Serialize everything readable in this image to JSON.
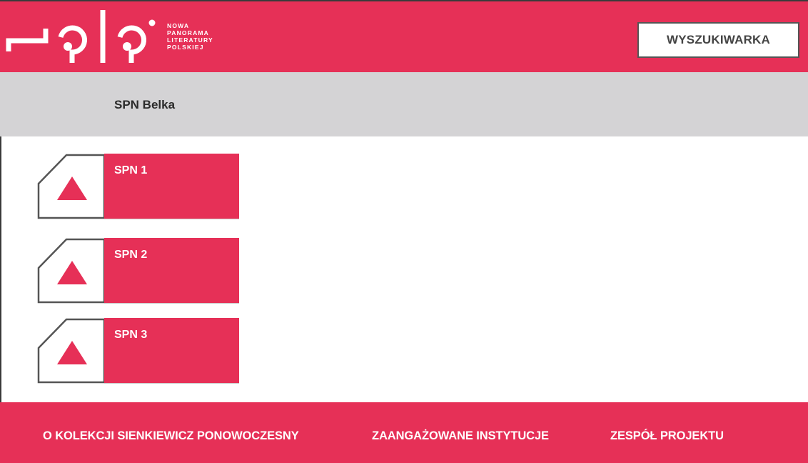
{
  "colors": {
    "accent": "#e63057",
    "band": "#d4d3d5",
    "text_dark": "#2b2b2b",
    "outline": "#555555"
  },
  "logo": {
    "icon": "nplp-logo-icon",
    "lines": [
      "NOWA",
      "PANORAMA",
      "LITERATURY",
      "POLSKIEJ"
    ]
  },
  "header": {
    "search_label": "WYSZUKIWARKA"
  },
  "band": {
    "title": "SPN Belka"
  },
  "items": [
    {
      "label": "SPN 1",
      "icon": "triangle-icon"
    },
    {
      "label": "SPN 2",
      "icon": "triangle-icon"
    },
    {
      "label": "SPN 3",
      "icon": "triangle-icon"
    }
  ],
  "footer": {
    "links": [
      "O KOLEKCJI SIENKIEWICZ PONOWOCZESNY",
      "ZAANGAŻOWANE INSTYTUCJE",
      "ZESPÓŁ PROJEKTU"
    ]
  }
}
